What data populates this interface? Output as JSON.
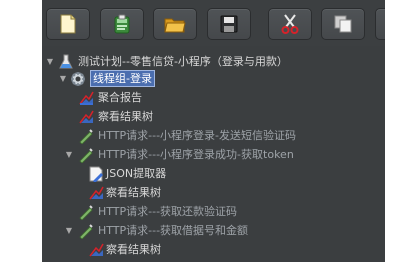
{
  "toolbar": {
    "buttons": [
      {
        "name": "new-icon"
      },
      {
        "name": "templates-icon"
      },
      {
        "name": "open-folder-icon"
      },
      {
        "name": "save-icon"
      },
      {
        "name": "cut-icon"
      },
      {
        "name": "copy-icon"
      }
    ]
  },
  "tree": {
    "items": [
      {
        "label": "测试计划--零售信贷-小程序（登录与用款）",
        "icon": "test-plan-icon"
      },
      {
        "label": "线程组-登录",
        "icon": "thread-group-icon"
      },
      {
        "label": "聚合报告",
        "icon": "aggregate-report-icon"
      },
      {
        "label": "察看结果树",
        "icon": "view-results-tree-icon"
      },
      {
        "label": "HTTP请求---小程序登录-发送短信验证码",
        "icon": "http-request-icon"
      },
      {
        "label": "HTTP请求---小程序登录成功-获取token",
        "icon": "http-request-icon"
      },
      {
        "label": "JSON提取器",
        "icon": "json-extractor-icon"
      },
      {
        "label": "察看结果树",
        "icon": "view-results-tree-icon"
      },
      {
        "label": "HTTP请求---获取还款验证码",
        "icon": "http-request-icon"
      },
      {
        "label": "HTTP请求---获取借据号和金额",
        "icon": "http-request-icon"
      },
      {
        "label": "察看结果树",
        "icon": "view-results-tree-icon"
      }
    ]
  },
  "colors": {
    "background": "#3b3e40",
    "selection": "#4b6eaf",
    "text": "#d8d8d8",
    "disabled_text": "#9ea3a8"
  }
}
